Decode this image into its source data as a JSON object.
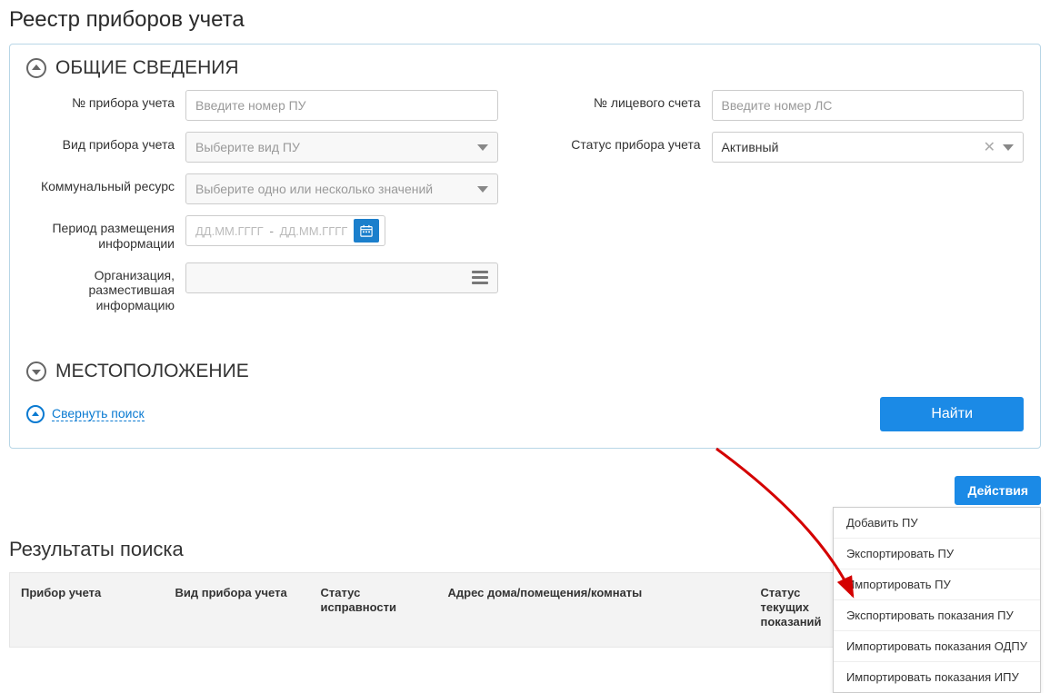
{
  "pageTitle": "Реестр приборов учета",
  "sections": {
    "general": {
      "title": "ОБЩИЕ СВЕДЕНИЯ"
    },
    "location": {
      "title": "МЕСТОПОЛОЖЕНИЕ"
    }
  },
  "form": {
    "meterNo": {
      "label": "№ прибора учета",
      "placeholder": "Введите номер ПУ",
      "value": ""
    },
    "meterType": {
      "label": "Вид прибора учета",
      "placeholder": "Выберите вид ПУ",
      "value": ""
    },
    "resource": {
      "label": "Коммунальный ресурс",
      "placeholder": "Выберите одно или несколько значений",
      "value": ""
    },
    "period": {
      "label": "Период размещения информации",
      "placeholderFrom": "ДД.ММ.ГГГГ",
      "placeholderTo": "ДД.ММ.ГГГГ"
    },
    "org": {
      "label": "Организация, разместившая информацию",
      "value": ""
    },
    "accountNo": {
      "label": "№ лицевого счета",
      "placeholder": "Введите номер ЛС",
      "value": ""
    },
    "status": {
      "label": "Статус прибора учета",
      "value": "Активный"
    }
  },
  "footer": {
    "collapseLink": "Свернуть поиск",
    "searchBtn": "Найти"
  },
  "actions": {
    "button": "Действия",
    "items": [
      "Добавить ПУ",
      "Экспортировать ПУ",
      "Импортировать ПУ",
      "Экспортировать показания ПУ",
      "Импортировать показания ОДПУ",
      "Импортировать показания ИПУ"
    ]
  },
  "results": {
    "title": "Результаты поиска",
    "columns": [
      "Прибор учета",
      "Вид прибора учета",
      "Статус исправности",
      "Адрес дома/помещения/комнаты",
      "Статус текущих показаний"
    ]
  }
}
